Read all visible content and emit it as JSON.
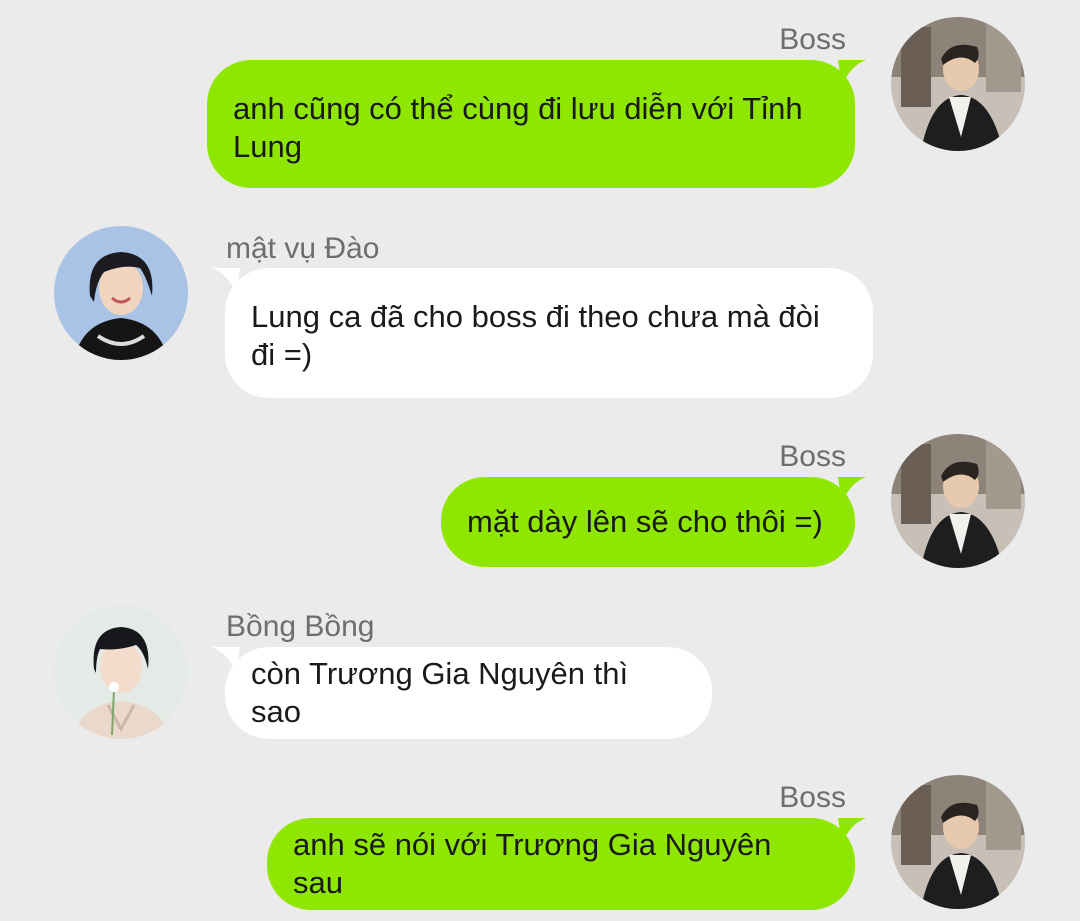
{
  "colors": {
    "background": "#ebebeb",
    "outgoing_bubble": "#8fe600",
    "incoming_bubble": "#ffffff",
    "sender_name": "#6e6e6e",
    "message_text": "#1a1a1a"
  },
  "messages": [
    {
      "direction": "outgoing",
      "sender": "Boss",
      "text_lines": [
        "anh cũng có thể cùng đi lưu diễn với Tỉnh",
        "Lung"
      ],
      "avatar": "boss-avatar"
    },
    {
      "direction": "incoming",
      "sender": "mật vụ Đào",
      "text_lines": [
        "Lung ca đã cho boss đi theo chưa mà đòi",
        "đi =)"
      ],
      "avatar": "dao-avatar"
    },
    {
      "direction": "outgoing",
      "sender": "Boss",
      "text_lines": [
        "mặt dày lên sẽ cho thôi =)"
      ],
      "avatar": "boss-avatar"
    },
    {
      "direction": "incoming",
      "sender": "Bồng Bồng",
      "text_lines": [
        "còn Trương Gia Nguyên thì sao"
      ],
      "avatar": "bong-avatar"
    },
    {
      "direction": "outgoing",
      "sender": "Boss",
      "text_lines": [
        "anh sẽ nói với Trương Gia Nguyên sau"
      ],
      "avatar": "boss-avatar"
    }
  ]
}
